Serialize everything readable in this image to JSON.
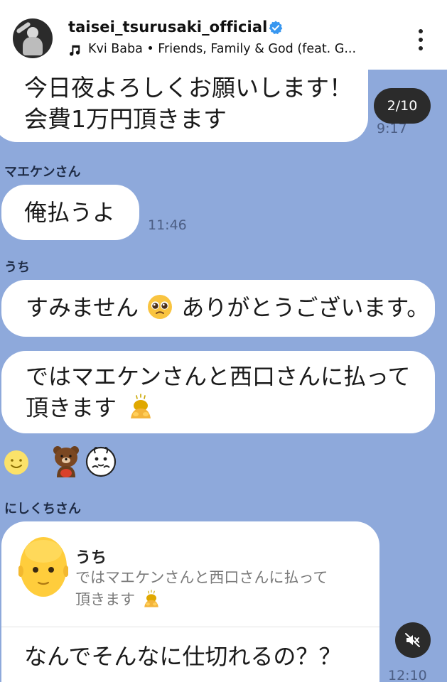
{
  "header": {
    "username": "taisei_tsurusaki_official",
    "song": "Kvi Baba • Friends, Family & God (feat. G...",
    "verified": true
  },
  "story": {
    "counter": "2/10"
  },
  "messages": {
    "m1": {
      "lines": [
        "今日夜よろしくお願いします！",
        "会費1万円頂きます"
      ],
      "time": "9:17"
    },
    "m2": {
      "sender": "マエケンさん",
      "text": "俺払うよ",
      "time": "11:46"
    },
    "m3": {
      "sender": "うち",
      "text_before": "すみません",
      "text_after": "ありがとうございます。"
    },
    "m4": {
      "line1": "ではマエケンさんと西口さんに払って",
      "line2": "頂きます"
    },
    "m5": {
      "sender": "にしくちさん",
      "reply_name": "うち",
      "reply_line1": "ではマエケンさんと西口さんに払って",
      "reply_line2": "頂きます",
      "text": "なんでそんなに仕切れるの？？",
      "time": "12:10"
    }
  },
  "icons": {
    "verified": "verified-badge-icon",
    "music": "music-note-icon",
    "more": "more-vertical-icon",
    "mute": "speaker-muted-icon",
    "sticker_smile": "smile-sticker",
    "sticker_bear": "brown-bear-sticker",
    "sticker_rabbit": "rabbit-sticker",
    "emoji_pleading": "pleading-face-emoji",
    "emoji_bow": "bowing-person-emoji"
  },
  "colors": {
    "chat_background": "#8ea9db",
    "bubble": "#ffffff",
    "verified": "#3897f0"
  }
}
